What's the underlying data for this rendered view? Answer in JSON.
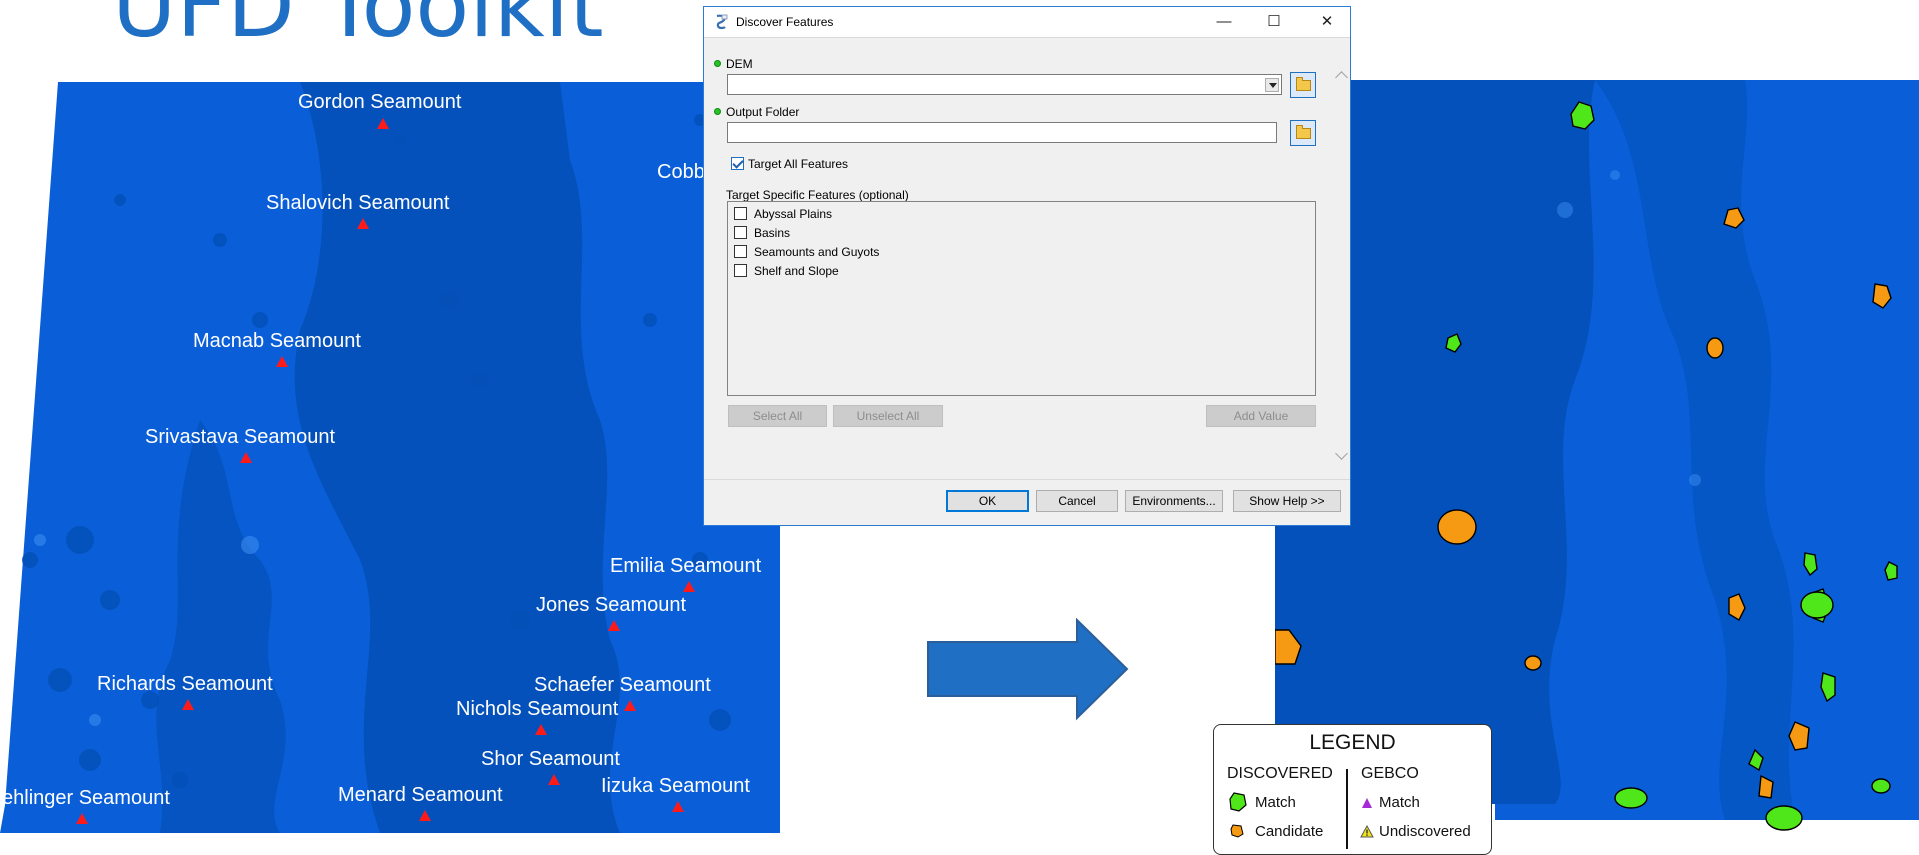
{
  "slide": {
    "title": "UFD Toolkit"
  },
  "left_map": {
    "seamounts": [
      {
        "name": "Gordon Seamount"
      },
      {
        "name": "Cobb"
      },
      {
        "name": "Shalovich Seamount"
      },
      {
        "name": "Macnab Seamount"
      },
      {
        "name": "Srivastava Seamount"
      },
      {
        "name": "Emilia Seamount"
      },
      {
        "name": "Jones Seamount"
      },
      {
        "name": "Richards Seamount"
      },
      {
        "name": "Schaefer Seamount"
      },
      {
        "name": "Nichols Seamount"
      },
      {
        "name": "Shor Seamount"
      },
      {
        "name": "Iizuka Seamount"
      },
      {
        "name": "ehlinger Seamount"
      },
      {
        "name": "Menard Seamount"
      }
    ]
  },
  "dialog": {
    "title": "Discover Features",
    "dem_label": "DEM",
    "dem_value": "",
    "output_folder_label": "Output Folder",
    "output_folder_value": "",
    "target_all_label": "Target All Features",
    "target_all_checked": true,
    "target_specific_label": "Target Specific Features (optional)",
    "feature_options": [
      {
        "label": "Abyssal Plains",
        "checked": false
      },
      {
        "label": "Basins",
        "checked": false
      },
      {
        "label": "Seamounts and Guyots",
        "checked": false
      },
      {
        "label": "Shelf and Slope",
        "checked": false
      }
    ],
    "select_all_label": "Select All",
    "unselect_all_label": "Unselect All",
    "add_value_label": "Add Value",
    "ok_label": "OK",
    "cancel_label": "Cancel",
    "environments_label": "Environments...",
    "show_help_label": "Show Help >>",
    "minimize_glyph": "—",
    "maximize_glyph": "☐",
    "close_glyph": "✕"
  },
  "legend": {
    "title": "LEGEND",
    "discovered_header": "DISCOVERED",
    "gebco_header": "GEBCO",
    "match_label": "Match",
    "candidate_label": "Candidate",
    "gebco_match_label": "Match",
    "undiscovered_label": "Undiscovered"
  },
  "colors": {
    "ocean": "#0a5fd8",
    "ocean_dark": "#0450b8",
    "seamount_marker": "#ff1a1a",
    "match": "#4fe61a",
    "candidate": "#f59a12",
    "gebco_match": "#a52bd6",
    "undiscovered": "#f2e21a",
    "accent": "#1f6fc4"
  },
  "icons": {
    "dialog_app": "script-tool-icon",
    "browse": "folder-icon",
    "arrow": "right-arrow-icon"
  }
}
